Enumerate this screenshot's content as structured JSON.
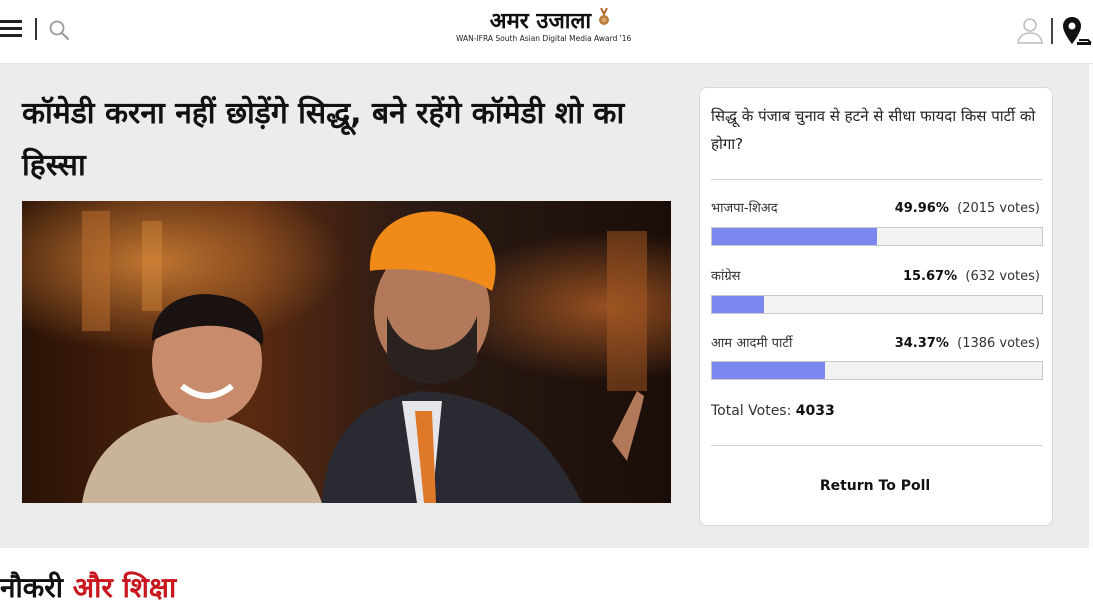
{
  "header": {
    "logo_text": "अमर उजाला",
    "award_text": "WAN-IFRA South Asian Digital Media Award '16"
  },
  "article": {
    "headline": "कॉमेडी करना नहीं छोड़ेंगे सिद्धू, बने रहेंगे कॉमेडी शो का हिस्सा"
  },
  "poll": {
    "question": "सिद्धू के पंजाब चुनाव से हटने से सीधा फायदा किस पार्टी को होगा?",
    "options": [
      {
        "label": "भाजपा-शिअद",
        "percent_text": "49.96%",
        "votes_text": "(2015 votes)",
        "fraction": 0.4996
      },
      {
        "label": "कांग्रेस",
        "percent_text": "15.67%",
        "votes_text": "(632 votes)",
        "fraction": 0.1567
      },
      {
        "label": "आम आदमी पार्टी",
        "percent_text": "34.37%",
        "votes_text": "(1386 votes)",
        "fraction": 0.3437
      }
    ],
    "total_label": "Total Votes:",
    "total_value": "4033",
    "return_label": "Return To Poll",
    "bar_color": "#7b88f2"
  },
  "section": {
    "title_part1": "नौकरी",
    "title_part2": "और शिक्षा",
    "accent_color": "#c8161d"
  }
}
